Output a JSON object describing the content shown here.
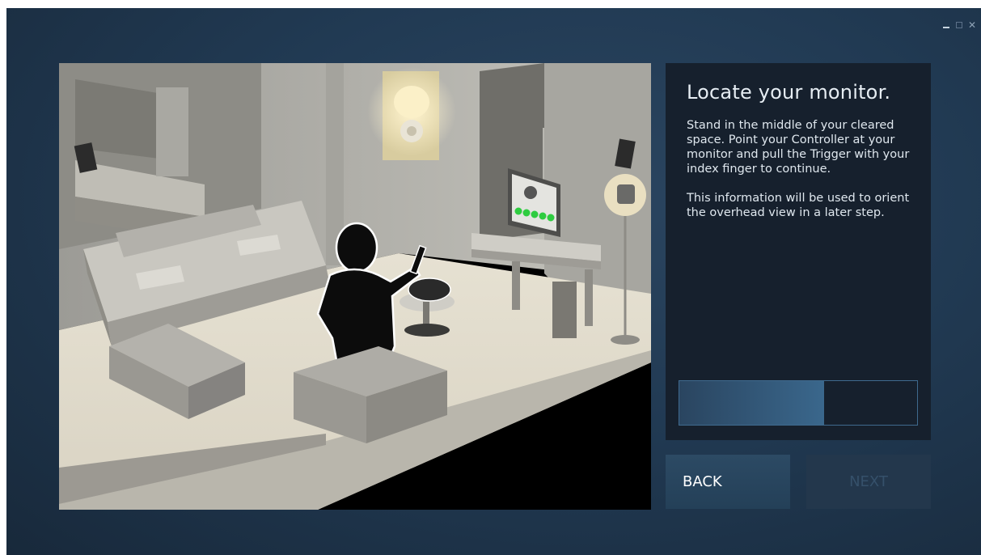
{
  "window": {
    "controls": {
      "minimize_icon": "minimize-icon",
      "maximize_icon": "maximize-icon",
      "close_symbol": "✕"
    }
  },
  "scene": {
    "icon": "living-room-illustration",
    "monitor_indicator_dots": 5
  },
  "panel": {
    "title": "Locate your monitor.",
    "paragraphs": [
      "Stand in the middle of your cleared space. Point your Controller at your monitor and pull the Trigger with your index finger to continue.",
      "This information will be used to orient the overhead view in a later step."
    ],
    "progress": 0.61
  },
  "buttons": {
    "back_label": "BACK",
    "next_label": "NEXT",
    "next_enabled": false
  },
  "colors": {
    "background": "#213a53",
    "panel": "#16202d",
    "accent": "#3a678c",
    "indicator_green": "#2ecc40"
  }
}
